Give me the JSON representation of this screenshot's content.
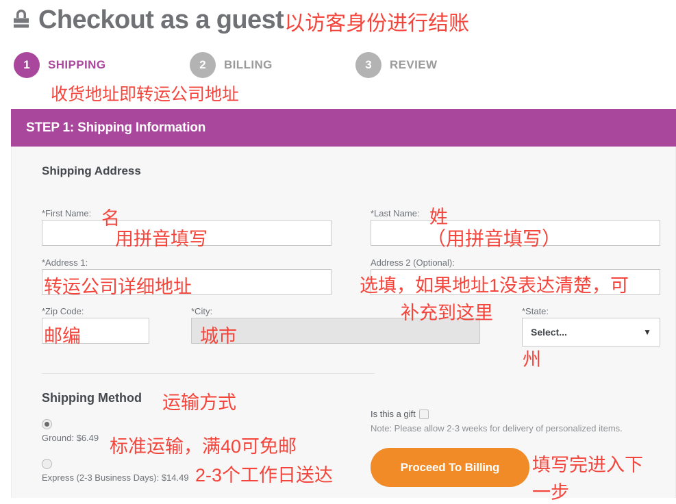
{
  "header": {
    "lock_icon": "lock-icon",
    "title": "Checkout as a guest",
    "title_annotation": "以访客身份进行结账"
  },
  "steps": {
    "note": "收货地址即转运公司地址",
    "items": [
      {
        "number": "1",
        "label": "SHIPPING",
        "state": "active"
      },
      {
        "number": "2",
        "label": "BILLING",
        "state": "inactive"
      },
      {
        "number": "3",
        "label": "REVIEW",
        "state": "inactive"
      }
    ]
  },
  "banner": {
    "title": "STEP 1: Shipping Information"
  },
  "form": {
    "section_title": "Shipping Address",
    "first_name": {
      "label": "*First Name:",
      "value": "",
      "annotation_1": "名",
      "annotation_2": "用拼音填写"
    },
    "last_name": {
      "label": "*Last Name:",
      "value": "",
      "annotation_1": "姓",
      "annotation_2": "（用拼音填写）"
    },
    "address_1": {
      "label": "*Address 1:",
      "value": "",
      "annotation": "转运公司详细地址"
    },
    "address_2": {
      "label": "Address 2 (Optional):",
      "value": "",
      "annotation_1": "选填，如果地址1没表达清楚，可",
      "annotation_2": "补充到这里"
    },
    "zip_code": {
      "label": "*Zip Code:",
      "value": "",
      "annotation": "邮编"
    },
    "city": {
      "label": "*City:",
      "value": "",
      "annotation": "城市"
    },
    "state": {
      "label": "*State:",
      "selected": "Select...",
      "caret": "chevron-down-icon",
      "annotation": "州"
    }
  },
  "shipping_method": {
    "title": "Shipping Method",
    "annotation": "运输方式",
    "options": [
      {
        "label": "Ground: $6.49",
        "selected": true,
        "annotation": "标准运输，满40可免邮"
      },
      {
        "label": "Express (2-3 Business Days): $14.49",
        "selected": false,
        "annotation": "2-3个工作日送达"
      }
    ]
  },
  "gift": {
    "label": "Is this a gift",
    "checked": false,
    "note": "Note: Please allow 2-3 weeks for delivery of personalized items."
  },
  "actions": {
    "proceed_label": "Proceed To Billing",
    "proceed_annotation_1": "填写完进入下",
    "proceed_annotation_2": "一步"
  },
  "colors": {
    "accent_purple": "#a8479c",
    "button_orange": "#f08b28",
    "annotation_red": "#f4453c",
    "panel_bg": "#f7f7f7"
  }
}
